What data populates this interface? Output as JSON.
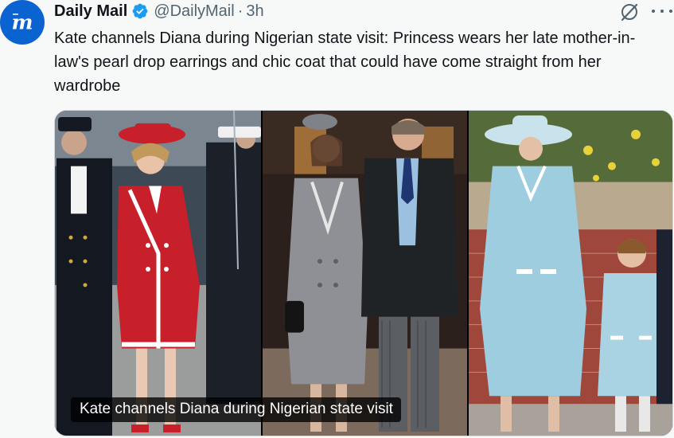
{
  "account": {
    "name": "Daily Mail",
    "handle": "@DailyMail",
    "separator": "·",
    "time": "3h",
    "avatar_icon": "daily-mail-logo",
    "verified_icon": "verified-badge-icon",
    "brand_color": "#0a63d1",
    "verified_color": "#1d9bf0"
  },
  "actions": {
    "grok_icon": "grok-slash-icon",
    "more_icon": "more-options-icon"
  },
  "tweet": {
    "text": "Kate channels Diana during Nigerian state visit: Princess wears her late mother-in-law's pearl drop earrings and chic coat that could have come straight from her wardrobe"
  },
  "media": {
    "photos": [
      {
        "subject": "woman in red and white coat with naval officers",
        "coat_color": "#c8202a"
      },
      {
        "subject": "woman in grey coat beside man in morning suit",
        "coat_color": "#8e9096"
      },
      {
        "subject": "woman in pale blue coat holding child's hand",
        "coat_color": "#9ecde0"
      }
    ],
    "caption": "Kate channels Diana during Nigerian state visit"
  }
}
